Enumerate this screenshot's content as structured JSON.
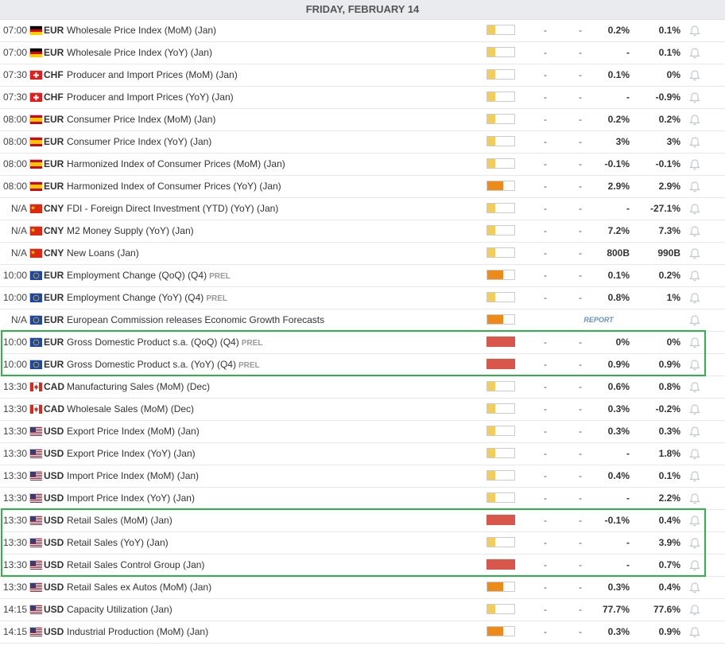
{
  "header": {
    "title": "FRIDAY, FEBRUARY 14"
  },
  "flags": {
    "de": {
      "stripes": [
        "#000000",
        "#dd0000",
        "#ffce00"
      ]
    },
    "ch": {
      "bg": "#e11d1d"
    },
    "es": {
      "stripes": [
        "#c60b1e",
        "#ffc400",
        "#c60b1e"
      ]
    },
    "cn": {
      "bg": "#de2910",
      "star": "#ffde00"
    },
    "eu": {
      "bg": "#1f47a8",
      "star": "#ffcc00"
    },
    "ca": {
      "bg": "#d52b1e"
    },
    "us": {
      "bg": "#b22234",
      "canton": "#3c3b6e"
    }
  },
  "impact_colors": {
    "low": "#f4cd58",
    "medium": "#ec8a1a",
    "high": "#d9574a"
  },
  "events": [
    {
      "time": "07:00",
      "flag": "de",
      "currency": "EUR",
      "name": "Wholesale Price Index (MoM) (Jan)",
      "tag": "",
      "impact": "low",
      "actual": "-",
      "deviation": "-",
      "consensus": "0.2%",
      "previous": "0.1%"
    },
    {
      "time": "07:00",
      "flag": "de",
      "currency": "EUR",
      "name": "Wholesale Price Index (YoY) (Jan)",
      "tag": "",
      "impact": "low",
      "actual": "-",
      "deviation": "-",
      "consensus": "-",
      "previous": "0.1%"
    },
    {
      "time": "07:30",
      "flag": "ch",
      "currency": "CHF",
      "name": "Producer and Import Prices (MoM) (Jan)",
      "tag": "",
      "impact": "low",
      "actual": "-",
      "deviation": "-",
      "consensus": "0.1%",
      "previous": "0%"
    },
    {
      "time": "07:30",
      "flag": "ch",
      "currency": "CHF",
      "name": "Producer and Import Prices (YoY) (Jan)",
      "tag": "",
      "impact": "low",
      "actual": "-",
      "deviation": "-",
      "consensus": "-",
      "previous": "-0.9%"
    },
    {
      "time": "08:00",
      "flag": "es",
      "currency": "EUR",
      "name": "Consumer Price Index (MoM) (Jan)",
      "tag": "",
      "impact": "low",
      "actual": "-",
      "deviation": "-",
      "consensus": "0.2%",
      "previous": "0.2%"
    },
    {
      "time": "08:00",
      "flag": "es",
      "currency": "EUR",
      "name": "Consumer Price Index (YoY) (Jan)",
      "tag": "",
      "impact": "low",
      "actual": "-",
      "deviation": "-",
      "consensus": "3%",
      "previous": "3%"
    },
    {
      "time": "08:00",
      "flag": "es",
      "currency": "EUR",
      "name": "Harmonized Index of Consumer Prices (MoM) (Jan)",
      "tag": "",
      "impact": "low",
      "actual": "-",
      "deviation": "-",
      "consensus": "-0.1%",
      "previous": "-0.1%"
    },
    {
      "time": "08:00",
      "flag": "es",
      "currency": "EUR",
      "name": "Harmonized Index of Consumer Prices (YoY) (Jan)",
      "tag": "",
      "impact": "medium",
      "actual": "-",
      "deviation": "-",
      "consensus": "2.9%",
      "previous": "2.9%"
    },
    {
      "time": "N/A",
      "flag": "cn",
      "currency": "CNY",
      "name": "FDI - Foreign Direct Investment (YTD) (YoY) (Jan)",
      "tag": "",
      "impact": "low",
      "actual": "-",
      "deviation": "-",
      "consensus": "-",
      "previous": "-27.1%"
    },
    {
      "time": "N/A",
      "flag": "cn",
      "currency": "CNY",
      "name": "M2 Money Supply (YoY) (Jan)",
      "tag": "",
      "impact": "low",
      "actual": "-",
      "deviation": "-",
      "consensus": "7.2%",
      "previous": "7.3%"
    },
    {
      "time": "N/A",
      "flag": "cn",
      "currency": "CNY",
      "name": "New Loans (Jan)",
      "tag": "",
      "impact": "low",
      "actual": "-",
      "deviation": "-",
      "consensus": "800B",
      "previous": "990B"
    },
    {
      "time": "10:00",
      "flag": "eu",
      "currency": "EUR",
      "name": "Employment Change (QoQ) (Q4)",
      "tag": "PREL",
      "impact": "medium",
      "actual": "-",
      "deviation": "-",
      "consensus": "0.1%",
      "previous": "0.2%"
    },
    {
      "time": "10:00",
      "flag": "eu",
      "currency": "EUR",
      "name": "Employment Change (YoY) (Q4)",
      "tag": "PREL",
      "impact": "low",
      "actual": "-",
      "deviation": "-",
      "consensus": "0.8%",
      "previous": "1%"
    },
    {
      "time": "N/A",
      "flag": "eu",
      "currency": "EUR",
      "name": "European Commission releases Economic Growth Forecasts",
      "tag": "",
      "impact": "medium",
      "actual": "",
      "deviation": "",
      "consensus": "",
      "previous": "",
      "report": "REPORT"
    },
    {
      "time": "10:00",
      "flag": "eu",
      "currency": "EUR",
      "name": "Gross Domestic Product s.a. (QoQ) (Q4)",
      "tag": "PREL",
      "impact": "high",
      "actual": "-",
      "deviation": "-",
      "consensus": "0%",
      "previous": "0%"
    },
    {
      "time": "10:00",
      "flag": "eu",
      "currency": "EUR",
      "name": "Gross Domestic Product s.a. (YoY) (Q4)",
      "tag": "PREL",
      "impact": "high",
      "actual": "-",
      "deviation": "-",
      "consensus": "0.9%",
      "previous": "0.9%"
    },
    {
      "time": "13:30",
      "flag": "ca",
      "currency": "CAD",
      "name": "Manufacturing Sales (MoM) (Dec)",
      "tag": "",
      "impact": "low",
      "actual": "-",
      "deviation": "-",
      "consensus": "0.6%",
      "previous": "0.8%"
    },
    {
      "time": "13:30",
      "flag": "ca",
      "currency": "CAD",
      "name": "Wholesale Sales (MoM) (Dec)",
      "tag": "",
      "impact": "low",
      "actual": "-",
      "deviation": "-",
      "consensus": "0.3%",
      "previous": "-0.2%"
    },
    {
      "time": "13:30",
      "flag": "us",
      "currency": "USD",
      "name": "Export Price Index (MoM) (Jan)",
      "tag": "",
      "impact": "low",
      "actual": "-",
      "deviation": "-",
      "consensus": "0.3%",
      "previous": "0.3%"
    },
    {
      "time": "13:30",
      "flag": "us",
      "currency": "USD",
      "name": "Export Price Index (YoY) (Jan)",
      "tag": "",
      "impact": "low",
      "actual": "-",
      "deviation": "-",
      "consensus": "-",
      "previous": "1.8%"
    },
    {
      "time": "13:30",
      "flag": "us",
      "currency": "USD",
      "name": "Import Price Index (MoM) (Jan)",
      "tag": "",
      "impact": "low",
      "actual": "-",
      "deviation": "-",
      "consensus": "0.4%",
      "previous": "0.1%"
    },
    {
      "time": "13:30",
      "flag": "us",
      "currency": "USD",
      "name": "Import Price Index (YoY) (Jan)",
      "tag": "",
      "impact": "low",
      "actual": "-",
      "deviation": "-",
      "consensus": "-",
      "previous": "2.2%"
    },
    {
      "time": "13:30",
      "flag": "us",
      "currency": "USD",
      "name": "Retail Sales (MoM) (Jan)",
      "tag": "",
      "impact": "high",
      "actual": "-",
      "deviation": "-",
      "consensus": "-0.1%",
      "previous": "0.4%"
    },
    {
      "time": "13:30",
      "flag": "us",
      "currency": "USD",
      "name": "Retail Sales (YoY) (Jan)",
      "tag": "",
      "impact": "low",
      "actual": "-",
      "deviation": "-",
      "consensus": "-",
      "previous": "3.9%"
    },
    {
      "time": "13:30",
      "flag": "us",
      "currency": "USD",
      "name": "Retail Sales Control Group (Jan)",
      "tag": "",
      "impact": "high",
      "actual": "-",
      "deviation": "-",
      "consensus": "-",
      "previous": "0.7%"
    },
    {
      "time": "13:30",
      "flag": "us",
      "currency": "USD",
      "name": "Retail Sales ex Autos (MoM) (Jan)",
      "tag": "",
      "impact": "medium",
      "actual": "-",
      "deviation": "-",
      "consensus": "0.3%",
      "previous": "0.4%"
    },
    {
      "time": "14:15",
      "flag": "us",
      "currency": "USD",
      "name": "Capacity Utilization (Jan)",
      "tag": "",
      "impact": "low",
      "actual": "-",
      "deviation": "-",
      "consensus": "77.7%",
      "previous": "77.6%"
    },
    {
      "time": "14:15",
      "flag": "us",
      "currency": "USD",
      "name": "Industrial Production (MoM) (Jan)",
      "tag": "",
      "impact": "medium",
      "actual": "-",
      "deviation": "-",
      "consensus": "0.3%",
      "previous": "0.9%"
    }
  ],
  "highlight_color": "#2db34a",
  "highlight_groups": [
    {
      "first_row": 14,
      "last_row": 15
    },
    {
      "first_row": 22,
      "last_row": 24
    }
  ]
}
